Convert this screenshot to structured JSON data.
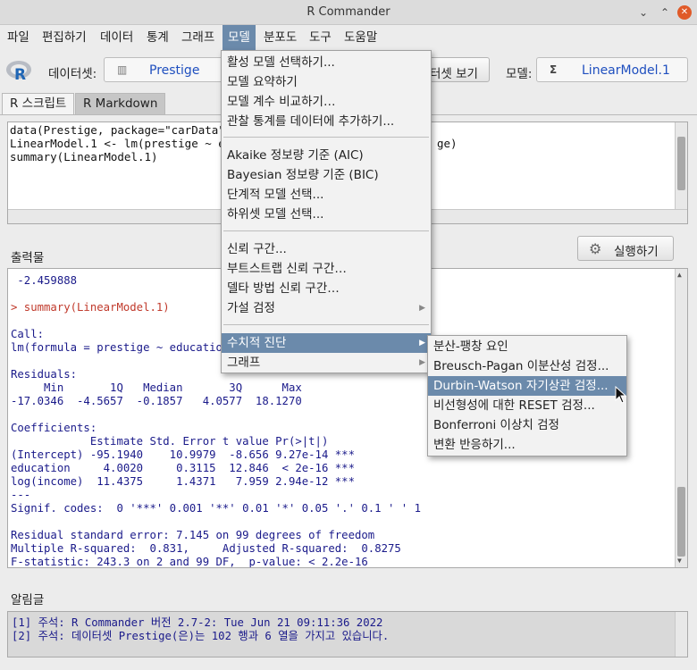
{
  "window": {
    "title": "R Commander"
  },
  "menubar": [
    "파일",
    "편집하기",
    "데이터",
    "통계",
    "그래프",
    "모델",
    "분포도",
    "도구",
    "도움말"
  ],
  "toolbar": {
    "dataset_label": "데이터셋:",
    "dataset_value": "Prestige",
    "view_dataset_button": "터셋 보기",
    "model_label": "모델:",
    "model_value": "LinearModel.1",
    "model_icon": "Σ"
  },
  "tabs": [
    "R 스크립트",
    "R Markdown"
  ],
  "script": {
    "lines": [
      "data(Prestige, package=\"carData\")",
      "LinearModel.1 <- lm(prestige ~ edu",
      "summary(LinearModel.1)"
    ],
    "tail_text": "ge)"
  },
  "output": {
    "label": "출력물",
    "run_button": "실행하기",
    "lines": [
      " -2.459888",
      "",
      "> summary(LinearModel.1)",
      "",
      "Call:",
      "lm(formula = prestige ~ education",
      "",
      "Residuals:",
      "     Min       1Q   Median       3Q      Max ",
      "-17.0346  -4.5657  -0.1857   4.0577  18.1270 ",
      "",
      "Coefficients:",
      "            Estimate Std. Error t value Pr(>|t|)    ",
      "(Intercept) -95.1940    10.9979  -8.656 9.27e-14 ***",
      "education     4.0020     0.3115  12.846  < 2e-16 ***",
      "log(income)  11.4375     1.4371   7.959 2.94e-12 ***",
      "---",
      "Signif. codes:  0 '***' 0.001 '**' 0.01 '*' 0.05 '.' 0.1 ' ' 1",
      "",
      "Residual standard error: 7.145 on 99 degrees of freedom",
      "Multiple R-squared:  0.831,\tAdjusted R-squared:  0.8275 ",
      "F-statistic: 243.3 on 2 and 99 DF,  p-value: < 2.2e-16"
    ]
  },
  "messages": {
    "label": "알림글",
    "lines": [
      "[1] 주석: R Commander 버전 2.7-2: Tue Jun 21 09:11:36 2022",
      "[2] 주석: 데이터셋 Prestige(은)는 102 행과 6 열을 가지고 있습니다."
    ]
  },
  "model_menu": {
    "groups": [
      [
        "활성 모델 선택하기...",
        "모델 요약하기",
        "모델 계수 비교하기…",
        "관찰 통계를 데이터에 추가하기..."
      ],
      [
        "Akaike 정보량 기준 (AIC)",
        "Bayesian 정보량 기준 (BIC)",
        "단계적 모델 선택...",
        "하위셋 모델 선택..."
      ],
      [
        "신뢰 구간...",
        "부트스트랩 신뢰 구간…",
        "델타 방법 신뢰 구간…",
        "가설 검정"
      ],
      [
        "수치적 진단",
        "그래프"
      ]
    ],
    "submenu_arrows": [
      "가설 검정",
      "수치적 진단",
      "그래프"
    ],
    "highlighted": "수치적 진단"
  },
  "diagnostics_menu": {
    "items": [
      "분산-팽창 요인",
      "Breusch-Pagan 이분산성 검정...",
      "Durbin-Watson 자기상관 검정...",
      "비선형성에 대한 RESET 검정...",
      "Bonferroni 이상치 검정",
      "변환 반응하기..."
    ],
    "highlighted": "Durbin-Watson 자기상관 검정..."
  },
  "colors": {
    "highlight": "#6b8aab",
    "output_text": "#1a1a8a",
    "command_text": "#c0392b",
    "value_text": "#1f4fbf"
  }
}
